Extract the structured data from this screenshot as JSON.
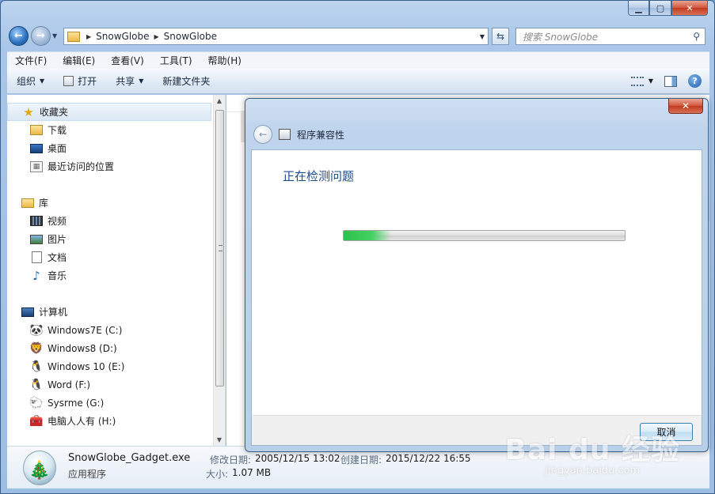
{
  "address": {
    "crumbs": [
      "SnowGlobe",
      "SnowGlobe"
    ],
    "search_placeholder": "搜索 SnowGlobe"
  },
  "menu": [
    "文件(F)",
    "编辑(E)",
    "查看(V)",
    "工具(T)",
    "帮助(H)"
  ],
  "toolbar": {
    "organize": "组织",
    "open": "打开",
    "share": "共享",
    "new_folder": "新建文件夹"
  },
  "nav": {
    "favorites": {
      "label": "收藏夹",
      "items": [
        "下载",
        "桌面",
        "最近访问的位置"
      ]
    },
    "libraries": {
      "label": "库",
      "items": [
        "视频",
        "图片",
        "文档",
        "音乐"
      ]
    },
    "computer": {
      "label": "计算机",
      "items": [
        "Windows7E (C:)",
        "Windows8 (D:)",
        "Windows 10 (E:)",
        "Word (F:)",
        "Sysrme (G:)",
        "电脑人人有 (H:)"
      ]
    }
  },
  "details": {
    "name": "SnowGlobe_Gadget.exe",
    "type": "应用程序",
    "modified_label": "修改日期:",
    "modified_value": "2005/12/15 13:02",
    "created_label": "创建日期:",
    "created_value": "2015/12/22 16:55",
    "size_label": "大小:",
    "size_value": "1.07 MB"
  },
  "dialog": {
    "title": "程序兼容性",
    "heading": "正在检测问题",
    "progress": 0.17,
    "cancel": "取消"
  },
  "watermark": {
    "logo": "Bai du 经验",
    "url": "jingyan.baidu.com"
  },
  "colors": {
    "accent": "#1f4e8c",
    "progress": "#2cc24a"
  }
}
